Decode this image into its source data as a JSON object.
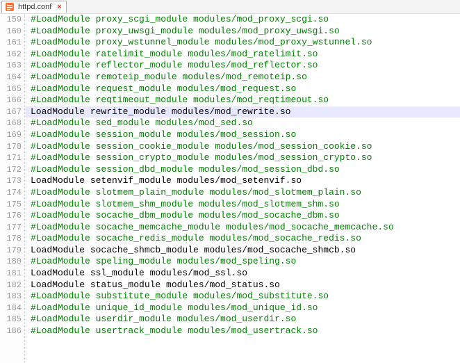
{
  "tab": {
    "icon_name": "file-icon",
    "title": "httpd.conf",
    "close_glyph": "×"
  },
  "editor": {
    "first_line": 159,
    "highlighted_line": 167,
    "lines": [
      {
        "text": "#LoadModule proxy_scgi_module modules/mod_proxy_scgi.so",
        "commented": true
      },
      {
        "text": "#LoadModule proxy_uwsgi_module modules/mod_proxy_uwsgi.so",
        "commented": true
      },
      {
        "text": "#LoadModule proxy_wstunnel_module modules/mod_proxy_wstunnel.so",
        "commented": true
      },
      {
        "text": "#LoadModule ratelimit_module modules/mod_ratelimit.so",
        "commented": true
      },
      {
        "text": "#LoadModule reflector_module modules/mod_reflector.so",
        "commented": true
      },
      {
        "text": "#LoadModule remoteip_module modules/mod_remoteip.so",
        "commented": true
      },
      {
        "text": "#LoadModule request_module modules/mod_request.so",
        "commented": true
      },
      {
        "text": "#LoadModule reqtimeout_module modules/mod_reqtimeout.so",
        "commented": true
      },
      {
        "text": "LoadModule rewrite_module modules/mod_rewrite.so",
        "commented": false
      },
      {
        "text": "#LoadModule sed_module modules/mod_sed.so",
        "commented": true
      },
      {
        "text": "#LoadModule session_module modules/mod_session.so",
        "commented": true
      },
      {
        "text": "#LoadModule session_cookie_module modules/mod_session_cookie.so",
        "commented": true
      },
      {
        "text": "#LoadModule session_crypto_module modules/mod_session_crypto.so",
        "commented": true
      },
      {
        "text": "#LoadModule session_dbd_module modules/mod_session_dbd.so",
        "commented": true
      },
      {
        "text": "LoadModule setenvif_module modules/mod_setenvif.so",
        "commented": false
      },
      {
        "text": "#LoadModule slotmem_plain_module modules/mod_slotmem_plain.so",
        "commented": true
      },
      {
        "text": "#LoadModule slotmem_shm_module modules/mod_slotmem_shm.so",
        "commented": true
      },
      {
        "text": "#LoadModule socache_dbm_module modules/mod_socache_dbm.so",
        "commented": true
      },
      {
        "text": "#LoadModule socache_memcache_module modules/mod_socache_memcache.so",
        "commented": true
      },
      {
        "text": "#LoadModule socache_redis_module modules/mod_socache_redis.so",
        "commented": true
      },
      {
        "text": "LoadModule socache_shmcb_module modules/mod_socache_shmcb.so",
        "commented": false
      },
      {
        "text": "#LoadModule speling_module modules/mod_speling.so",
        "commented": true
      },
      {
        "text": "LoadModule ssl_module modules/mod_ssl.so",
        "commented": false
      },
      {
        "text": "LoadModule status_module modules/mod_status.so",
        "commented": false
      },
      {
        "text": "#LoadModule substitute_module modules/mod_substitute.so",
        "commented": true
      },
      {
        "text": "#LoadModule unique_id_module modules/mod_unique_id.so",
        "commented": true
      },
      {
        "text": "#LoadModule userdir_module modules/mod_userdir.so",
        "commented": true
      },
      {
        "text": "#LoadModule usertrack_module modules/mod_usertrack.so",
        "commented": true
      }
    ]
  }
}
